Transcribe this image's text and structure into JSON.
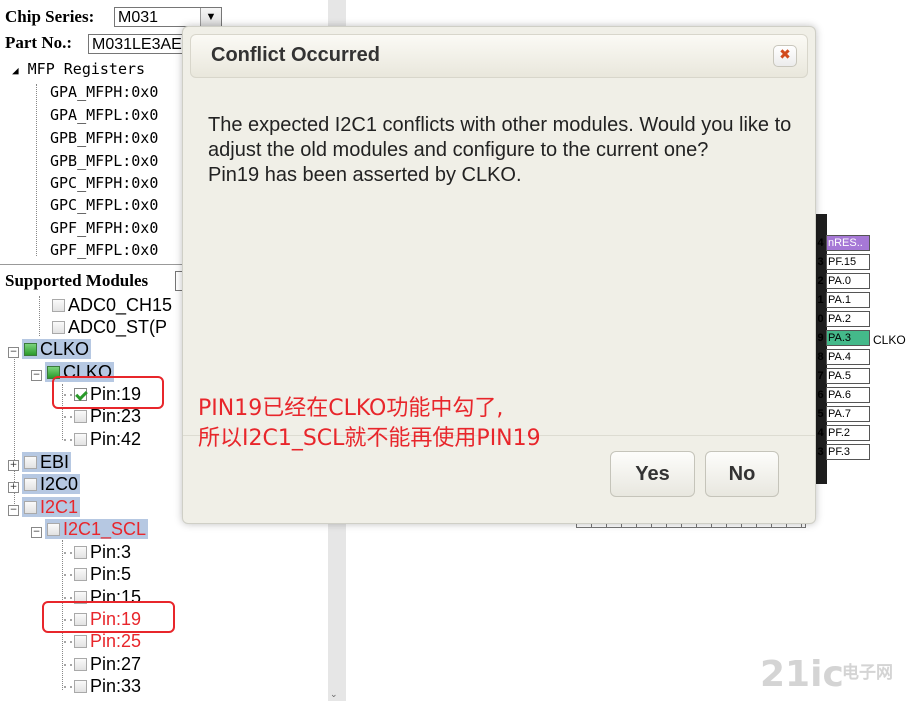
{
  "header": {
    "chip_series_label": "Chip Series:",
    "chip_series_value": "M031",
    "part_no_label": "Part No.:",
    "part_no_value": "M031LE3AE"
  },
  "mfp": {
    "root": "MFP Registers",
    "items": [
      "GPA_MFPH:0x0",
      "GPA_MFPL:0x0",
      "GPB_MFPH:0x0",
      "GPB_MFPL:0x0",
      "GPC_MFPH:0x0",
      "GPC_MFPL:0x0",
      "GPF_MFPH:0x0",
      "GPF_MFPL:0x0"
    ]
  },
  "modules": {
    "label": "Supported Modules",
    "adc_ch": "ADC0_CH15",
    "adc_st": "ADC0_ST(P",
    "clko": "CLKO",
    "clko_sub": "CLKO",
    "clko_pins": [
      "Pin:19",
      "Pin:23",
      "Pin:42"
    ],
    "ebi": "EBI",
    "i2c0": "I2C0",
    "i2c1": "I2C1",
    "i2c1_scl": "I2C1_SCL",
    "scl_pins": [
      "Pin:3",
      "Pin:5",
      "Pin:15",
      "Pin:19",
      "Pin:25",
      "Pin:27",
      "Pin:33"
    ]
  },
  "chip_pins": [
    {
      "num": "4",
      "label": "nRES.."
    },
    {
      "num": "3",
      "label": "PF.15"
    },
    {
      "num": "2",
      "label": "PA.0"
    },
    {
      "num": "1",
      "label": "PA.1"
    },
    {
      "num": "0",
      "label": "PA.2"
    },
    {
      "num": "9",
      "label": "PA.3"
    },
    {
      "num": "8",
      "label": "PA.4"
    },
    {
      "num": "7",
      "label": "PA.5"
    },
    {
      "num": "6",
      "label": "PA.6"
    },
    {
      "num": "5",
      "label": "PA.7"
    },
    {
      "num": "4",
      "label": "PF.2"
    },
    {
      "num": "3",
      "label": "PF.3"
    }
  ],
  "pin_function_label": "CLKO",
  "colors": {
    "nres": "#a678d6",
    "pa3": "#44b98a",
    "highlight": "#b6c8e2",
    "red": "#e8262b"
  },
  "dialog": {
    "title": "Conflict Occurred",
    "message_line1": "The expected I2C1 conflicts with other modules. Would you like to adjust the old modules and configure to the current one?",
    "message_line2": "Pin19 has been asserted by CLKO.",
    "yes_label": "Yes",
    "no_label": "No"
  },
  "annotation": {
    "line1": "PIN19已经在CLKO功能中勾了,",
    "line2": "所以I2C1_SCL就不能再使用PIN19"
  },
  "watermark": {
    "text1": "21ic",
    "text2": "电子网"
  }
}
